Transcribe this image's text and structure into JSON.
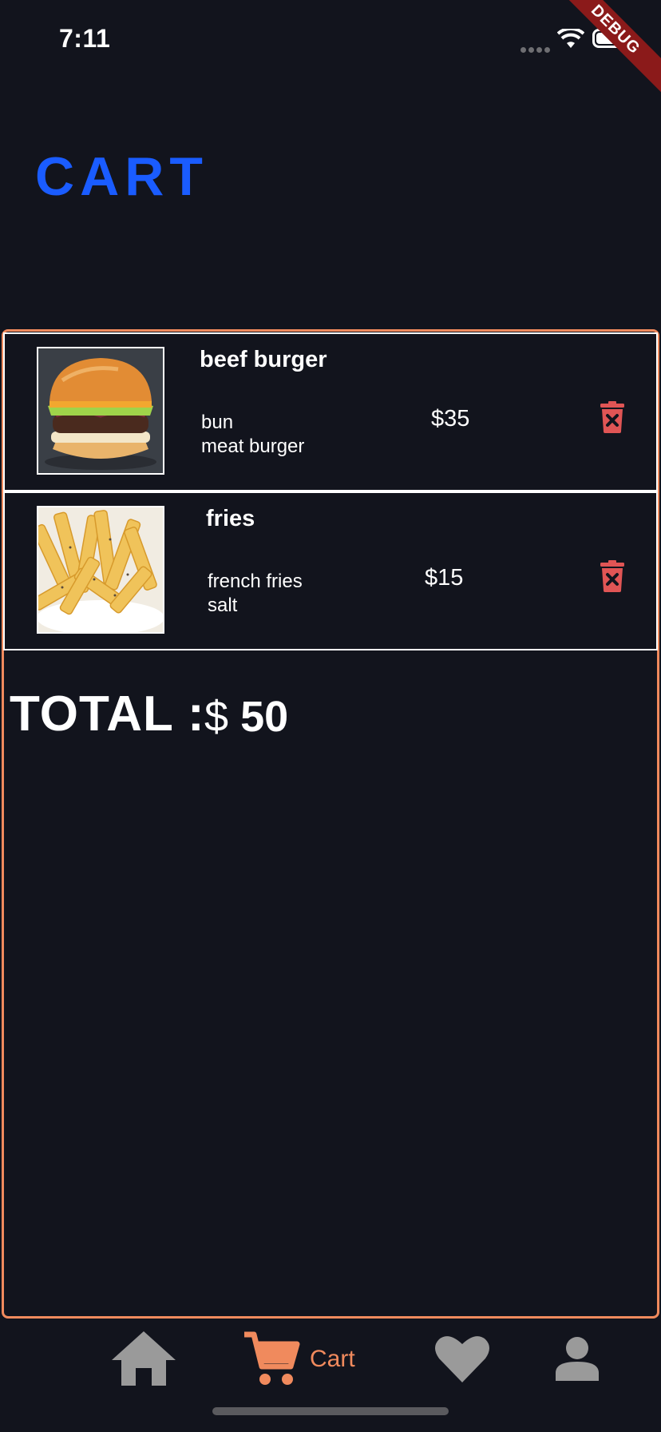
{
  "status_bar": {
    "time": "7:11",
    "debug_label": "DEBUG"
  },
  "page": {
    "title": "CART"
  },
  "cart": {
    "items": [
      {
        "name": "beef burger",
        "ingredients": [
          "bun",
          "meat burger"
        ],
        "price": "$35",
        "image": "burger-photo"
      },
      {
        "name": "fries",
        "ingredients": [
          "french fries",
          "salt"
        ],
        "price": "$15",
        "image": "fries-photo"
      }
    ],
    "total_label": "TOTAL :",
    "total_currency": "$",
    "total_amount": "50"
  },
  "nav": {
    "items": [
      {
        "icon": "home-icon"
      },
      {
        "icon": "cart-icon",
        "label": "Cart",
        "active": true
      },
      {
        "icon": "heart-icon"
      },
      {
        "icon": "person-icon"
      }
    ]
  },
  "colors": {
    "background": "#12141d",
    "accent": "#f08a5d",
    "title": "#1a5cff",
    "delete": "#e05555",
    "inactive": "#9a9a9a"
  }
}
